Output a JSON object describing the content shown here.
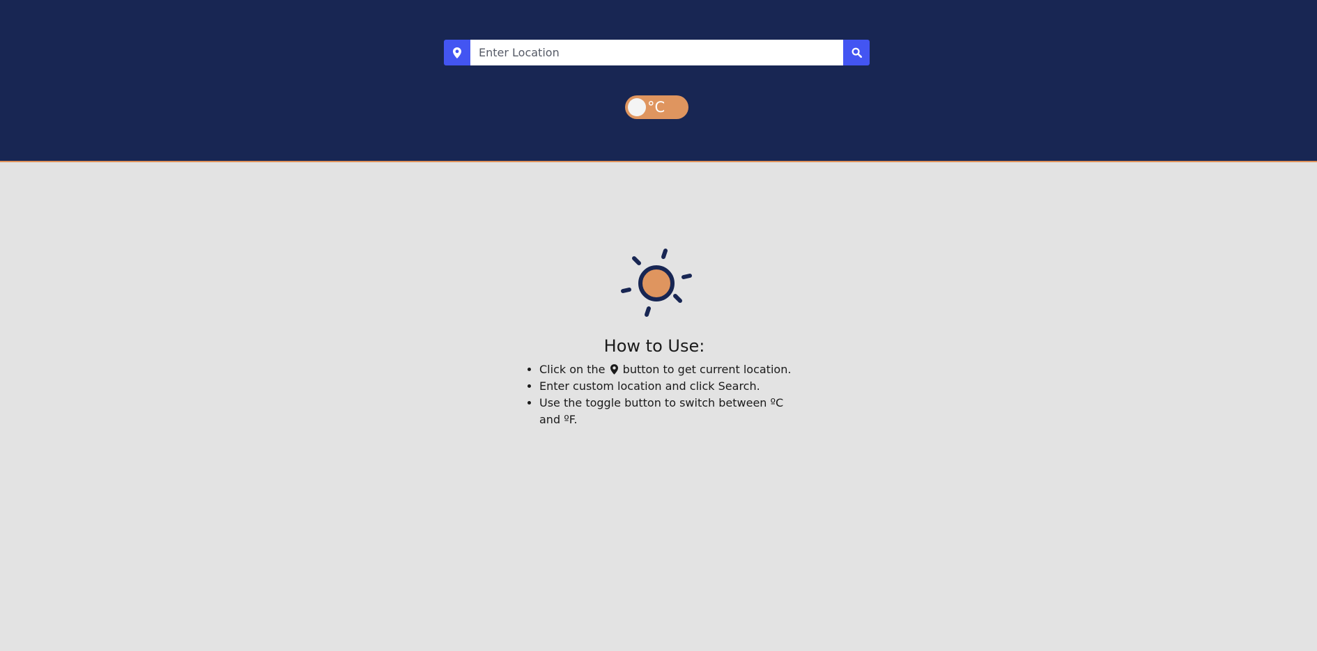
{
  "header": {
    "background": "#182653",
    "accent_border": "#e0935b"
  },
  "search": {
    "location_icon": "map-marker-icon",
    "placeholder": "Enter Location",
    "value": "",
    "search_icon": "search-icon",
    "button_color": "#4355f2"
  },
  "unit_toggle": {
    "label": "°C",
    "state": "celsius",
    "color": "#df955f"
  },
  "illustration": {
    "icon": "sun-icon",
    "fill": "#df955f",
    "stroke": "#182653"
  },
  "instructions": {
    "title": "How to Use:",
    "items": [
      {
        "before": "Click on the",
        "icon": "map-marker-icon",
        "after": "button to get current location."
      },
      {
        "text": "Enter custom location and click Search."
      },
      {
        "text": "Use the toggle button to switch between ºC and ºF."
      }
    ]
  }
}
